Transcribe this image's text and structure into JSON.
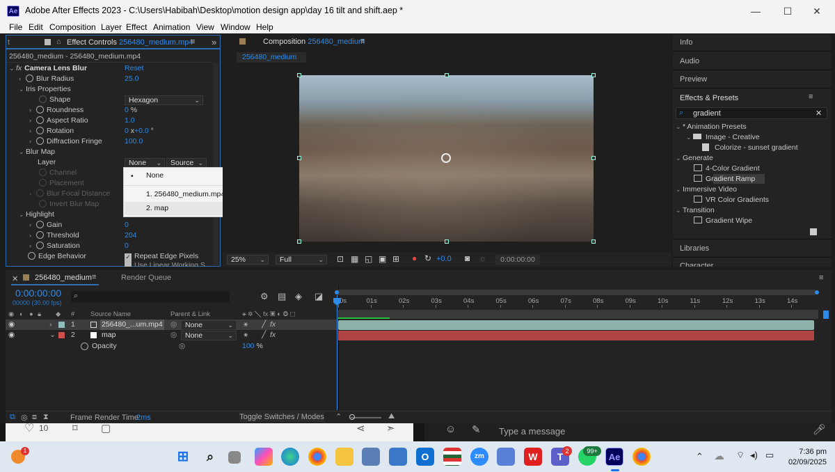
{
  "window": {
    "app_logo": "Ae",
    "title": "Adobe After Effects 2023 - C:\\Users\\Habibah\\Desktop\\motion design app\\day 16 tilt and shift.aep *",
    "minimize": "—",
    "maximize": "☐",
    "close": "✕"
  },
  "menu": [
    "File",
    "Edit",
    "Composition",
    "Layer",
    "Effect",
    "Animation",
    "View",
    "Window",
    "Help"
  ],
  "effect_controls": {
    "tab_prefix": "Effect Controls",
    "tab_file": "256480_medium.mp4",
    "left_stub": "t",
    "close": "✕",
    "subheader": "256480_medium - 256480_medium.mp4",
    "effect_name": "Camera Lens Blur",
    "reset": "Reset",
    "props": [
      {
        "label": "Blur Radius",
        "value": "25.0"
      },
      {
        "label": "Iris Properties",
        "value": ""
      },
      {
        "label": "Shape",
        "value": "Hexagon"
      },
      {
        "label": "Roundness",
        "value": "0",
        "unit": "%"
      },
      {
        "label": "Aspect Ratio",
        "value": "1.0"
      },
      {
        "label": "Rotation",
        "value": "0",
        "value2": "+0.0",
        "unit": "x",
        "unit2": "°"
      },
      {
        "label": "Diffraction Fringe",
        "value": "100.0"
      },
      {
        "label": "Blur Map",
        "value": ""
      },
      {
        "label": "Layer",
        "value": "None",
        "value2": "Source"
      },
      {
        "label": "Channel",
        "value": ""
      },
      {
        "label": "Placement",
        "value": ""
      },
      {
        "label": "Blur Focal Distance",
        "value": ""
      },
      {
        "label": "Invert Blur Map",
        "value": ""
      },
      {
        "label": "Highlight",
        "value": ""
      },
      {
        "label": "Gain",
        "value": "0"
      },
      {
        "label": "Threshold",
        "value": "204"
      },
      {
        "label": "Saturation",
        "value": "0"
      },
      {
        "label": "Edge Behavior",
        "value": "Repeat Edge Pixels",
        "value2": "Use Linear Working S..."
      }
    ]
  },
  "popup": {
    "items": [
      "None",
      "1. 256480_medium.mp4",
      "2. map"
    ],
    "selected_index": 0,
    "hover_index": 2,
    "bullet": "•"
  },
  "composition": {
    "tab_prefix": "Composition",
    "tab_name": "256480_medium",
    "flow_tab": "256480_medium",
    "zoom": "25%",
    "resolution": "Full",
    "exposure": "+0.0",
    "timecode": "0:00:00:00"
  },
  "right_panels": {
    "info": "Info",
    "audio": "Audio",
    "preview": "Preview",
    "effects_presets": "Effects & Presets",
    "search_value": "gradient",
    "libraries": "Libraries",
    "character": "Character",
    "tree": [
      {
        "label": "* Animation Presets",
        "level": 0,
        "icon": ""
      },
      {
        "label": "Image - Creative",
        "level": 1,
        "icon": "folder"
      },
      {
        "label": "Colorize - sunset gradient",
        "level": 2,
        "icon": "preset"
      },
      {
        "label": "Generate",
        "level": 0,
        "icon": ""
      },
      {
        "label": "4-Color Gradient",
        "level": 2,
        "icon": "effect"
      },
      {
        "label": "Gradient Ramp",
        "level": 2,
        "icon": "effect",
        "selected": true
      },
      {
        "label": "Immersive Video",
        "level": 0,
        "icon": ""
      },
      {
        "label": "VR Color Gradients",
        "level": 2,
        "icon": "effect"
      },
      {
        "label": "Transition",
        "level": 0,
        "icon": ""
      },
      {
        "label": "Gradient Wipe",
        "level": 2,
        "icon": "effect"
      }
    ]
  },
  "timeline": {
    "tab": "256480_medium",
    "render_queue": "Render Queue",
    "timecode": "0:00:00:00",
    "fps": "00000 (30.00 fps)",
    "col_num": "#",
    "col_source": "Source Name",
    "col_parent": "Parent & Link",
    "ruler": [
      "0s",
      "01s",
      "02s",
      "03s",
      "04s",
      "05s",
      "06s",
      "07s",
      "08s",
      "09s",
      "10s",
      "11s",
      "12s",
      "13s",
      "14s"
    ],
    "layers": [
      {
        "num": "1",
        "name": "256480_...um.mp4",
        "parent": "None",
        "color": "#8fbcbc"
      },
      {
        "num": "2",
        "name": "map",
        "parent": "None",
        "color": "#d05050"
      }
    ],
    "opacity_label": "Opacity",
    "opacity_value": "100",
    "opacity_unit": "%",
    "frame_render_label": "Frame Render Time:",
    "frame_render_value": "2ms",
    "toggle": "Toggle Switches / Modes"
  },
  "behind_apps": {
    "likes": "10",
    "message_placeholder": "Type a message"
  },
  "taskbar": {
    "weather_badge": "1",
    "teams_badge": "2",
    "whatsapp_badge": "99+",
    "time": "7:36 pm",
    "date": "02/09/2025"
  },
  "colors": {
    "accent": "#2d8ceb",
    "ae_purple": "#9999ff",
    "layer1": "#8fbcbc",
    "layer2": "#b04545",
    "selected_row": "#3c3c3c"
  }
}
